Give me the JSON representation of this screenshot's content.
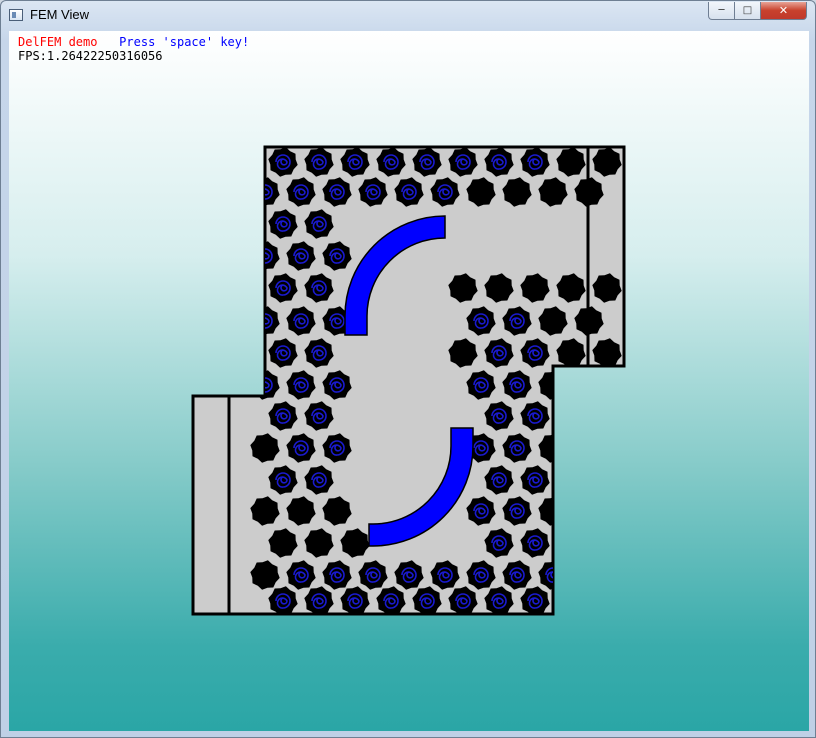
{
  "window": {
    "title": "FEM View",
    "controls": {
      "minimize": "─",
      "maximize": "□",
      "close": "✕"
    }
  },
  "overlay": {
    "demo_label": "DelFEM demo",
    "press_label": "Press 'space' key!",
    "fps": "FPS:1.26422250316056"
  },
  "colors": {
    "domain_fill": "#cccccc",
    "boundary": "#000000",
    "hole_fill": "#000000",
    "vortex": "#1a1ad0",
    "arc_fill": "#0000ff"
  },
  "icons": {
    "app": "window-icon",
    "minimize": "minimize-icon",
    "maximize": "maximize-icon",
    "close": "close-icon"
  }
}
